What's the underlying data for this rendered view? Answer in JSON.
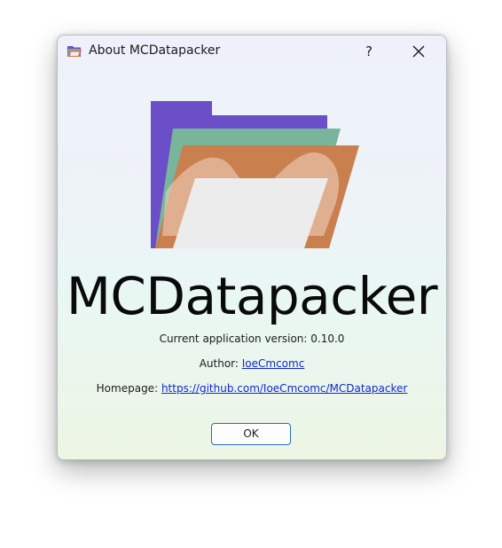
{
  "window": {
    "title": "About MCDatapacker",
    "help_label": "?"
  },
  "app": {
    "name": "MCDatapacker"
  },
  "info": {
    "version_text": "Current application version: 0.10.0",
    "author_label": "Author:",
    "author_name": "IoeCmcomc",
    "homepage_label": "Homepage:",
    "homepage_url": "https://github.com/IoeCmcomc/MCDatapacker"
  },
  "buttons": {
    "ok_label": "OK"
  },
  "icons": {
    "title": "folder-icon",
    "close": "close-icon",
    "logo": "app-logo-folder"
  },
  "colors": {
    "logo_purple": "#6b4fc8",
    "logo_green": "#79b59b",
    "logo_orange": "#c97f4e",
    "link": "#0d28d6",
    "ok_border": "#1f6fc7"
  }
}
